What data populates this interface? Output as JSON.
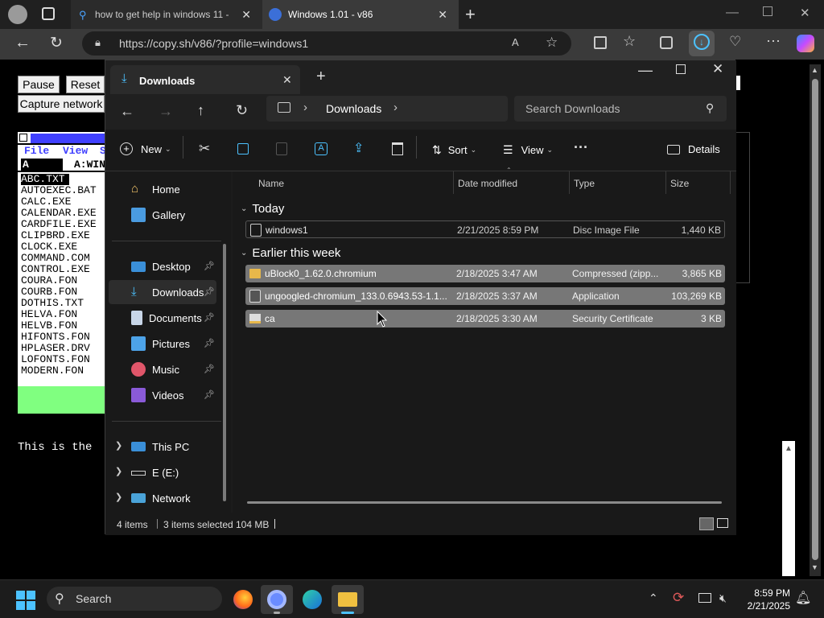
{
  "browser": {
    "tabs": [
      {
        "label": "how to get help in windows 11 -"
      },
      {
        "label": "Windows 1.01 - v86"
      }
    ],
    "url": "https://copy.sh/v86/?profile=windows1"
  },
  "page": {
    "buttons": {
      "pause": "Pause",
      "reset": "Reset",
      "capture": "Capture network"
    },
    "win101": {
      "menu_file": "File",
      "menu_view": "View",
      "menu_s": "S",
      "drive_label": "A",
      "path_label": "A:WIN",
      "files": [
        "ABC.TXT",
        "AUTOEXEC.BAT",
        "CALC.EXE",
        "CALENDAR.EXE",
        "CARDFILE.EXE",
        "CLIPBRD.EXE",
        "CLOCK.EXE",
        "COMMAND.COM",
        "CONTROL.EXE",
        "COURA.FON",
        "COURB.FON",
        "DOTHIS.TXT",
        "HELVA.FON",
        "HELVB.FON",
        "HIFONTS.FON",
        "HPLASER.DRV",
        "LOFONTS.FON",
        "MODERN.FON"
      ]
    },
    "terminal_text": "This is the"
  },
  "explorer": {
    "tab_title": "Downloads",
    "breadcrumb": "Downloads",
    "search_placeholder": "Search Downloads",
    "toolbar": {
      "new": "New",
      "sort": "Sort",
      "view": "View",
      "details": "Details"
    },
    "sidebar": {
      "top": [
        {
          "label": "Home"
        },
        {
          "label": "Gallery"
        }
      ],
      "quick": [
        {
          "label": "Desktop"
        },
        {
          "label": "Downloads"
        },
        {
          "label": "Documents"
        },
        {
          "label": "Pictures"
        },
        {
          "label": "Music"
        },
        {
          "label": "Videos"
        }
      ],
      "tree": [
        {
          "label": "This PC"
        },
        {
          "label": "E (E:)"
        },
        {
          "label": "Network"
        }
      ]
    },
    "columns": {
      "name": "Name",
      "date": "Date modified",
      "type": "Type",
      "size": "Size"
    },
    "groups": [
      {
        "label": "Today",
        "files": [
          {
            "name": "windows1",
            "date": "2/21/2025 8:59 PM",
            "type": "Disc Image File",
            "size": "1,440 KB",
            "selected": false
          }
        ]
      },
      {
        "label": "Earlier this week",
        "files": [
          {
            "name": "uBlock0_1.62.0.chromium",
            "date": "2/18/2025 3:47 AM",
            "type": "Compressed (zipp...",
            "size": "3,865 KB",
            "selected": true
          },
          {
            "name": "ungoogled-chromium_133.0.6943.53-1.1...",
            "date": "2/18/2025 3:37 AM",
            "type": "Application",
            "size": "103,269 KB",
            "selected": true
          },
          {
            "name": "ca",
            "date": "2/18/2025 3:30 AM",
            "type": "Security Certificate",
            "size": "3 KB",
            "selected": true
          }
        ]
      }
    ],
    "status": {
      "items": "4 items",
      "selected": "3 items selected",
      "size": "104 MB"
    }
  },
  "taskbar": {
    "search_label": "Search",
    "time": "8:59 PM",
    "date": "2/21/2025"
  },
  "colors": {
    "accent": "#4cc2ff",
    "selection": "#777777",
    "explorer_bg": "#191919",
    "win101_green": "#80ff80",
    "win101_blue": "#4040ff"
  }
}
